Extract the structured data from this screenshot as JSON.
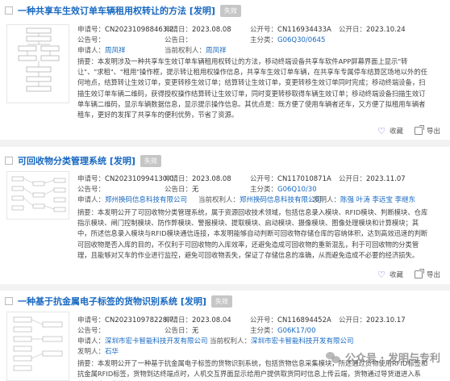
{
  "records": [
    {
      "title": "一种共享车生效订单车辆租用权转让的方法 [发明]",
      "status": "失效",
      "app_no_label": "申请号：",
      "app_no": "CN202310988463.2",
      "app_date_label": "申请日：",
      "app_date": "2023.08.08",
      "pub_no_label": "公开号：",
      "pub_no": "CN116934433A",
      "pub_date_label": "公开日：",
      "pub_date": "2023.10.24",
      "grant_no_label": "公告号：",
      "grant_no": "",
      "grant_date_label": "公告日：",
      "grant_date": "",
      "ipc_label": "主分类：",
      "ipc": "G06Q30/0645",
      "applicant_label": "申请人：",
      "applicant": "周凤祥",
      "owner_label": "当前权利人：",
      "owner": "周凤祥",
      "inventor_label": "",
      "inventor": [],
      "abstract_label": "摘要：",
      "abstract": "本发明涉及一种共享车生效订单车辆租用权转让的方法，移动终端设备共享车软件APP屏幕界面上显示\"转让\"、\"求租\"、\"租用\"操作框，提示转让租用权操作信息，共享车生效订单车辆，在共享车专属停车结算区场地以外的任何地点，结算转让生效订单，变更转移生效订单；结算转让生效订单，变更转移生效订单同时完成；移动终端设备，扫描生效订单车辆二维码，获得授权操作结算转让生效订单，同时变更转移取得车辆生效订单；移动终端设备扫描生效订单车辆二维码，显示车辆数据信息，显示提示操作信息。其优点是：既方便了使用车辆者还车，又方便了拟租用车辆者租车，更好的发挥了共享车的便利优势，节省了资源。",
      "fav": "收藏",
      "export": "导出"
    },
    {
      "title": "可回收物分类管理系统 [发明]",
      "status": "失效",
      "app_no_label": "申请号：",
      "app_no": "CN202310994130.0",
      "app_date_label": "申请日：",
      "app_date": "2023.08.08",
      "pub_no_label": "公开号：",
      "pub_no": "CN117010871A",
      "pub_date_label": "公开日：",
      "pub_date": "2023.11.07",
      "grant_no_label": "公告号：",
      "grant_no": "",
      "grant_date_label": "公告日：",
      "grant_date": "无",
      "ipc_label": "主分类：",
      "ipc": "G06Q10/30",
      "applicant_label": "申请人：",
      "applicant": "郑州换码信息科技有限公司",
      "owner_label": "当前权利人：",
      "owner": "郑州换码信息科技有限公司",
      "inventor_label": "发明人：",
      "inventor": [
        "陈强",
        "叶涛",
        "李远宝",
        "李继东"
      ],
      "abstract_label": "摘要：",
      "abstract": "本发明公开了可回收物分类管理系统，属于资源回收技术领域，包括信息录入模块、RFID模块、判断模块、仓库指示模块、闸门控制模块、防作弊模块、警报模块、提取模块、启动模块、摄像模块、图像处理模块和计算模块；其中，所述信息录入模块与RFID模块通信连接，本发明能够自动判断可回收物存储仓库的容纳体积，达到高效迅速的判断可回收物是否入库的目的，不仅利于可回收物的入库效率，还避免造成可回收物的重新混乱，利于可回收物的分类管理，且能够对又车的作业进行监控，避免可回收物丢失，保证了存储信息的准确，从而避免造成不必要的经济损失。",
      "fav": "收藏",
      "export": "导出"
    },
    {
      "title": "一种基于抗金属电子标签的货物识别系统 [发明]",
      "status": "失效",
      "app_no_label": "申请号：",
      "app_no": "CN202310978228.7",
      "app_date_label": "申请日：",
      "app_date": "2023.08.04",
      "pub_no_label": "公开号：",
      "pub_no": "CN116894452A",
      "pub_date_label": "公开日：",
      "pub_date": "2023.10.17",
      "grant_no_label": "公告号：",
      "grant_no": "",
      "grant_date_label": "公告日：",
      "grant_date": "无",
      "ipc_label": "主分类：",
      "ipc": "G06K17/00",
      "applicant_label": "申请人：",
      "applicant": "深圳市宏卡智能科技开发有限公司",
      "owner_label": "当前权利人：",
      "owner": "深圳市宏卡智能科技开发有限公司",
      "inventor_label": "发明人：",
      "inventor": [
        "石华"
      ],
      "abstract_label": "摘要：",
      "abstract": "本发明公开了一种基于抗金属电子标签的货物识别系统，包括货物信息采集模块，所述通过货物使用RFID标签和抗金属RFID标签，货物到达终端点时，人机交互界面显示给用户提供取货同时信息上传云端，货物通过导货道进入系统，标签回收模块",
      "fav": "收藏",
      "export": "导出"
    }
  ],
  "watermark": "公众号 · 发明与专利",
  "colors": {
    "link": "#1768c0",
    "badge": "#c6c6c6",
    "fav_heart": "#7b4fc9"
  }
}
